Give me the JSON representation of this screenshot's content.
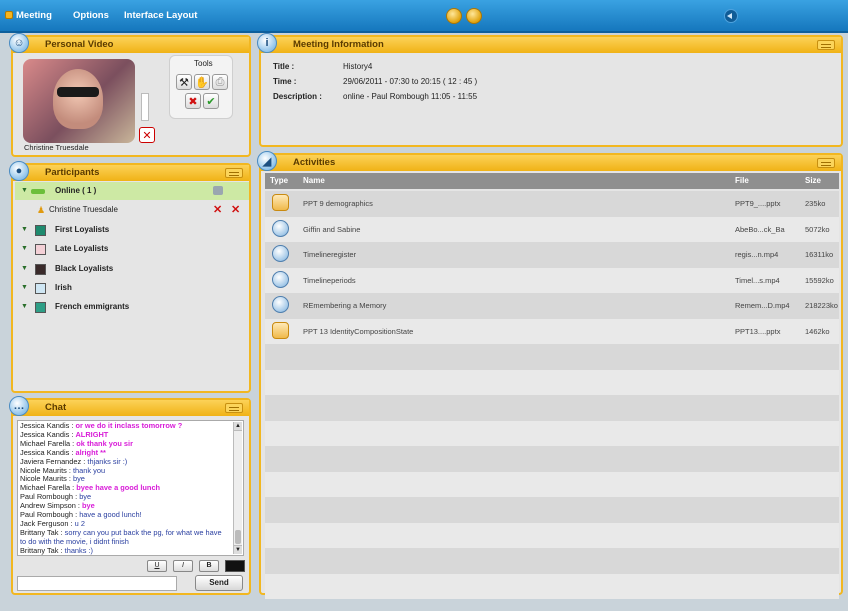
{
  "menu": {
    "items": [
      "Meeting",
      "Options",
      "Interface Layout"
    ]
  },
  "video": {
    "title": "Personal Video",
    "user_name": "Christine Truesdale",
    "tools_label": "Tools"
  },
  "info": {
    "title": "Meeting Information",
    "fields": [
      {
        "label": "Title :",
        "value": "History4"
      },
      {
        "label": "Time :",
        "value": "29/06/2011 - 07:30 to 20:15 ( 12 : 45 )"
      },
      {
        "label": "Description :",
        "value": "online - Paul Rombough  11:05 - 11:55"
      }
    ]
  },
  "participants": {
    "title": "Participants",
    "online_label": "Online ( 1 )",
    "user_name": "Christine Truesdale",
    "groups": [
      {
        "label": "First Loyalists",
        "color": "#1e8a6e"
      },
      {
        "label": "Late Loyalists",
        "color": "#f3d0d6"
      },
      {
        "label": "Black Loyalists",
        "color": "#3a2a2a"
      },
      {
        "label": "Irish",
        "color": "#cfe6f3"
      },
      {
        "label": "French emmigrants",
        "color": "#2e9e86"
      }
    ]
  },
  "chat": {
    "title": "Chat",
    "messages": [
      {
        "user": "Jessica Kandis",
        "text": "or we do it inclass tomorrow ?",
        "color": "#d81bd8"
      },
      {
        "user": "Jessica Kandis",
        "text": "ALRIGHT",
        "color": "#d81bd8"
      },
      {
        "user": "Michael Farella",
        "text": "ok thank you sir",
        "color": "#d81bd8"
      },
      {
        "user": "Jessica Kandis",
        "text": "alright **",
        "color": "#d81bd8"
      },
      {
        "user": "Javiera Fernandez",
        "text": "thjanks sir :)",
        "color": "#2a3fa0"
      },
      {
        "user": "Nicole Maurits",
        "text": "thank you",
        "color": "#2a3fa0"
      },
      {
        "user": "Nicole Maurits",
        "text": "bye",
        "color": "#2a3fa0"
      },
      {
        "user": "Michael Farella",
        "text": "byee have a good lunch",
        "color": "#d81bd8"
      },
      {
        "user": "Paul Rombough",
        "text": "bye",
        "color": "#2a3fa0"
      },
      {
        "user": "Andrew Simpson",
        "text": "bye",
        "color": "#d81bd8"
      },
      {
        "user": "Paul Rombough",
        "text": "have a good lunch!",
        "color": "#2a3fa0"
      },
      {
        "user": "Jack Ferguson",
        "text": "u 2",
        "color": "#2a3fa0"
      },
      {
        "user": "Brittany Tak",
        "text": "sorry can you put back the pg, for what we have",
        "color": "#2a3fa0"
      },
      {
        "user": "",
        "text": "to do with the movie, i didnt finish",
        "color": "#2a3fa0"
      },
      {
        "user": "Brittany Tak",
        "text": "thanks :)",
        "color": "#2a3fa0"
      }
    ],
    "format_buttons": [
      "U",
      "I",
      "B"
    ],
    "send_label": "Send"
  },
  "activities": {
    "title": "Activities",
    "columns": [
      "Type",
      "Name",
      "File",
      "Size"
    ],
    "rows": [
      {
        "type": "ppt",
        "name": "PPT 9 demographics",
        "file": "PPT9_....pptx",
        "size": "235ko"
      },
      {
        "type": "video",
        "name": "Giffin and Sabine",
        "file": "AbeBo...ck_Ba",
        "size": "5072ko"
      },
      {
        "type": "video",
        "name": "Timelineregister",
        "file": "regis...n.mp4",
        "size": "16311ko"
      },
      {
        "type": "video",
        "name": "Timelineperiods",
        "file": "Timel...s.mp4",
        "size": "15592ko"
      },
      {
        "type": "video",
        "name": "REmembering a Memory",
        "file": "Remem...D.mp4",
        "size": "218223ko"
      },
      {
        "type": "ppt",
        "name": "PPT 13 IdentityCompositionState",
        "file": "PPT13....pptx",
        "size": "1462ko"
      }
    ]
  }
}
